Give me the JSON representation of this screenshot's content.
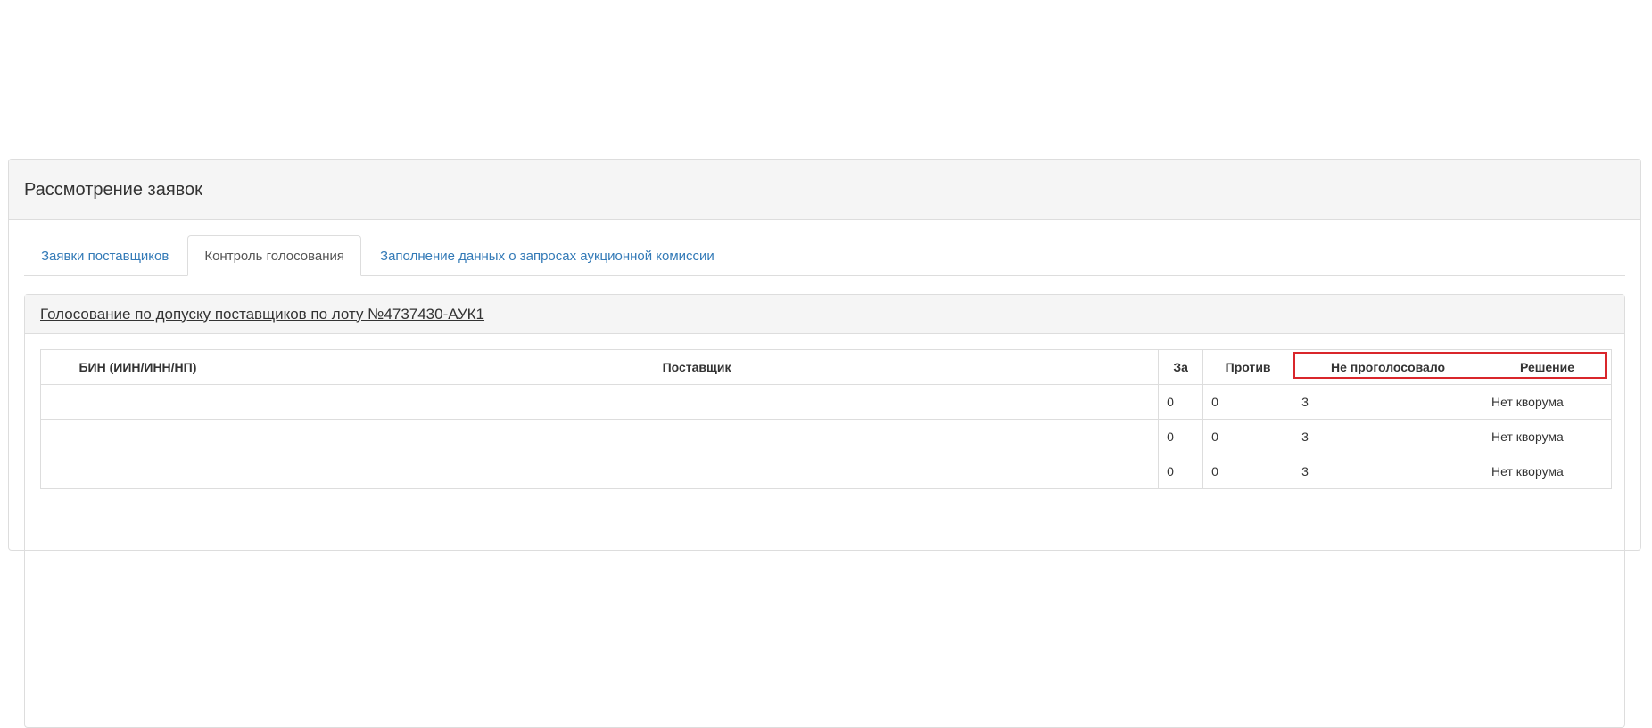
{
  "panel": {
    "title": "Рассмотрение заявок"
  },
  "tabs": [
    {
      "label": "Заявки поставщиков",
      "active": false
    },
    {
      "label": "Контроль голосования",
      "active": true
    },
    {
      "label": "Заполнение данных о запросах аукционной комиссии",
      "active": false
    }
  ],
  "voting": {
    "title": "Голосование по допуску поставщиков по лоту №4737430-АУК1",
    "columns": [
      "БИН (ИИН/ИНН/НП)",
      "Поставщик",
      "За",
      "Против",
      "Не проголосовало",
      "Решение"
    ],
    "rows": [
      {
        "bin": "",
        "supplier": "",
        "for": "0",
        "against": "0",
        "not_voted": "3",
        "decision": "Нет кворума"
      },
      {
        "bin": "",
        "supplier": "",
        "for": "0",
        "against": "0",
        "not_voted": "3",
        "decision": "Нет кворума"
      },
      {
        "bin": "",
        "supplier": "",
        "for": "0",
        "against": "0",
        "not_voted": "3",
        "decision": "Нет кворума"
      }
    ]
  },
  "colors": {
    "link": "#337ab7",
    "highlight_border": "#d9262b",
    "heading_bg": "#f5f5f5"
  }
}
